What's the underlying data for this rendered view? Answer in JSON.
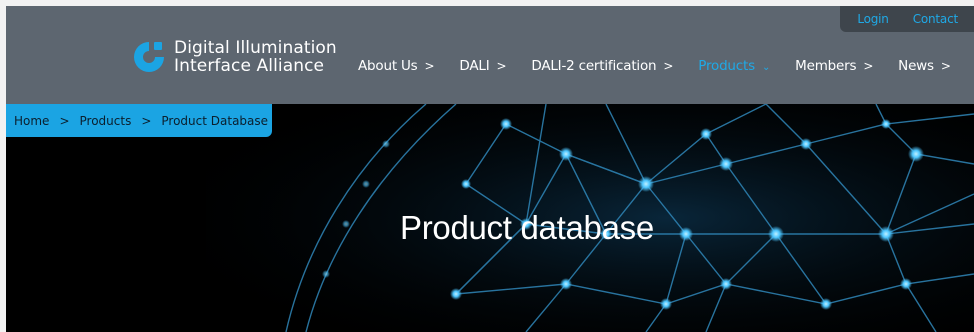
{
  "utility_nav": {
    "login": "Login",
    "contact": "Contact"
  },
  "logo": {
    "line1": "Digital Illumination",
    "line2": "Interface Alliance"
  },
  "nav": {
    "items": [
      {
        "label": "About Us",
        "indicator": ">"
      },
      {
        "label": "DALI",
        "indicator": ">"
      },
      {
        "label": "DALI-2 certification",
        "indicator": ">"
      },
      {
        "label": "Products",
        "indicator": "⌄"
      },
      {
        "label": "Members",
        "indicator": ">"
      },
      {
        "label": "News",
        "indicator": ">"
      }
    ],
    "active_index": 3
  },
  "breadcrumb": {
    "items": [
      "Home",
      "Products",
      "Product Database"
    ],
    "separator": ">"
  },
  "hero": {
    "title": "Product database"
  },
  "colors": {
    "header_bg": "#5d6670",
    "accent": "#1ba4e3",
    "utility_bg": "#3e454c",
    "network_line": "#2f86b8",
    "network_node": "#5fd0ff"
  }
}
